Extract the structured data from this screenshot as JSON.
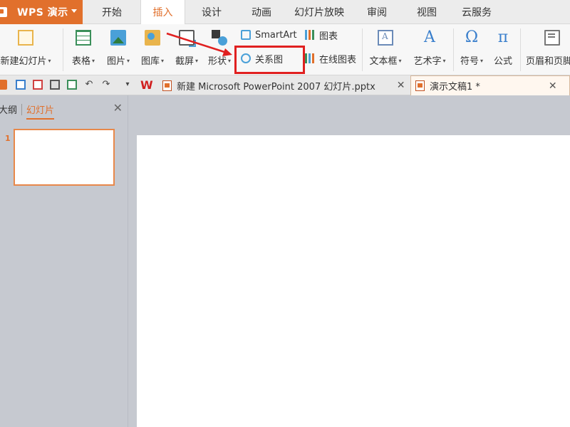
{
  "app": {
    "title": "WPS 演示",
    "menu_caret": "▾"
  },
  "menu_tabs": [
    {
      "label": "开始",
      "active": false
    },
    {
      "label": "插入",
      "active": true
    },
    {
      "label": "设计",
      "active": false
    },
    {
      "label": "动画",
      "active": false
    },
    {
      "label": "幻灯片放映",
      "active": false
    },
    {
      "label": "审阅",
      "active": false
    },
    {
      "label": "视图",
      "active": false
    },
    {
      "label": "云服务",
      "active": false
    }
  ],
  "ribbon": {
    "new_slide": "新建幻灯片",
    "table": "表格",
    "picture": "图片",
    "gallery": "图库",
    "screenshot": "截屏",
    "shape": "形状",
    "smartart": "SmartArt",
    "chart": "图表",
    "relation_diagram": "关系图",
    "online_chart": "在线图表",
    "textbox": "文本框",
    "art_text": "艺术字",
    "symbol": "符号",
    "formula": "公式",
    "header_footer": "页眉和页脚",
    "dropdown_glyph": "▾",
    "icons": {
      "symbol": "Ω",
      "formula": "π",
      "art_text": "A"
    }
  },
  "quick_access": {
    "undo": "↶",
    "redo": "↷",
    "more": "▾"
  },
  "doc_tabs": [
    {
      "label": "新建 Microsoft PowerPoint 2007 幻灯片.pptx",
      "active": false
    },
    {
      "label": "演示文稿1 *",
      "active": true
    }
  ],
  "doc_tab_close": "✕",
  "wps_logo": "W",
  "left_panel": {
    "tab_outline": "大纲",
    "tab_slides": "幻灯片",
    "close": "✕",
    "slide_number": "1"
  },
  "colors": {
    "accent": "#e1702c",
    "highlight": "#e02020",
    "panel_bg": "#c6c9d0"
  }
}
